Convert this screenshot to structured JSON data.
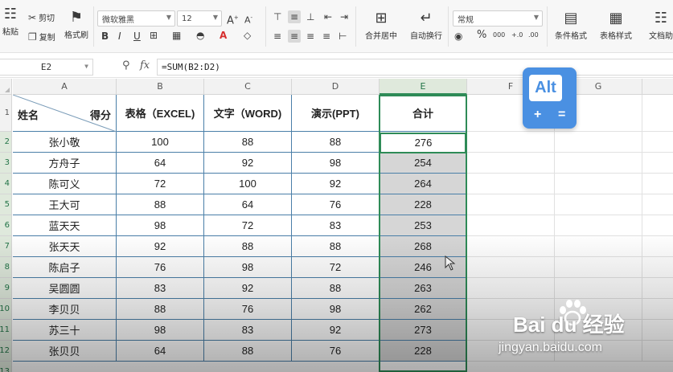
{
  "toolbar": {
    "paste_label": "粘贴",
    "cut_label": "剪切",
    "copy_label": "复制",
    "format_painter_label": "格式刷",
    "font_name": "微软雅黑",
    "font_size": "12",
    "merge_center_label": "合并居中",
    "wrap_text_label": "自动换行",
    "number_format": "常规",
    "conditional_format_label": "条件格式",
    "table_style_label": "表格样式",
    "doc_assist_label": "文档助"
  },
  "formula_bar": {
    "cell_ref": "E2",
    "fx_label": "fx",
    "formula": "=SUM(B2:D2)"
  },
  "columns": [
    "A",
    "B",
    "C",
    "D",
    "E",
    "F",
    "G"
  ],
  "active_column": "E",
  "rows": [
    "1",
    "2",
    "3",
    "4",
    "5",
    "6",
    "7",
    "8",
    "9",
    "10",
    "11",
    "12",
    "13"
  ],
  "table": {
    "header_name": "姓名",
    "header_score": "得分",
    "headers": [
      "表格（EXCEL)",
      "文字（WORD)",
      "演示(PPT)",
      "合计"
    ],
    "data": [
      {
        "name": "张小敬",
        "b": "100",
        "c": "88",
        "d": "88",
        "e": "276"
      },
      {
        "name": "方舟子",
        "b": "64",
        "c": "92",
        "d": "98",
        "e": "254"
      },
      {
        "name": "陈可义",
        "b": "72",
        "c": "100",
        "d": "92",
        "e": "264"
      },
      {
        "name": "王大可",
        "b": "88",
        "c": "64",
        "d": "76",
        "e": "228"
      },
      {
        "name": "蓝天天",
        "b": "98",
        "c": "72",
        "d": "83",
        "e": "253"
      },
      {
        "name": "张天天",
        "b": "92",
        "c": "88",
        "d": "88",
        "e": "268"
      },
      {
        "name": "陈启子",
        "b": "76",
        "c": "98",
        "d": "72",
        "e": "246"
      },
      {
        "name": "吴圆圆",
        "b": "83",
        "c": "92",
        "d": "88",
        "e": "263"
      },
      {
        "name": "李贝贝",
        "b": "88",
        "c": "76",
        "d": "98",
        "e": "262"
      },
      {
        "name": "苏三十",
        "b": "98",
        "c": "83",
        "d": "92",
        "e": "273"
      },
      {
        "name": "张贝贝",
        "b": "64",
        "c": "88",
        "d": "76",
        "e": "228"
      }
    ]
  },
  "overlay": {
    "key_label": "Alt",
    "plus": "+",
    "equals": "=",
    "accent": "#4a90e2"
  },
  "watermark": {
    "brand": "Bai  du 经验",
    "url": "jingyan.baidu.com"
  },
  "colors": {
    "selection_border": "#2e8b57",
    "table_border": "#4a7fa8"
  }
}
